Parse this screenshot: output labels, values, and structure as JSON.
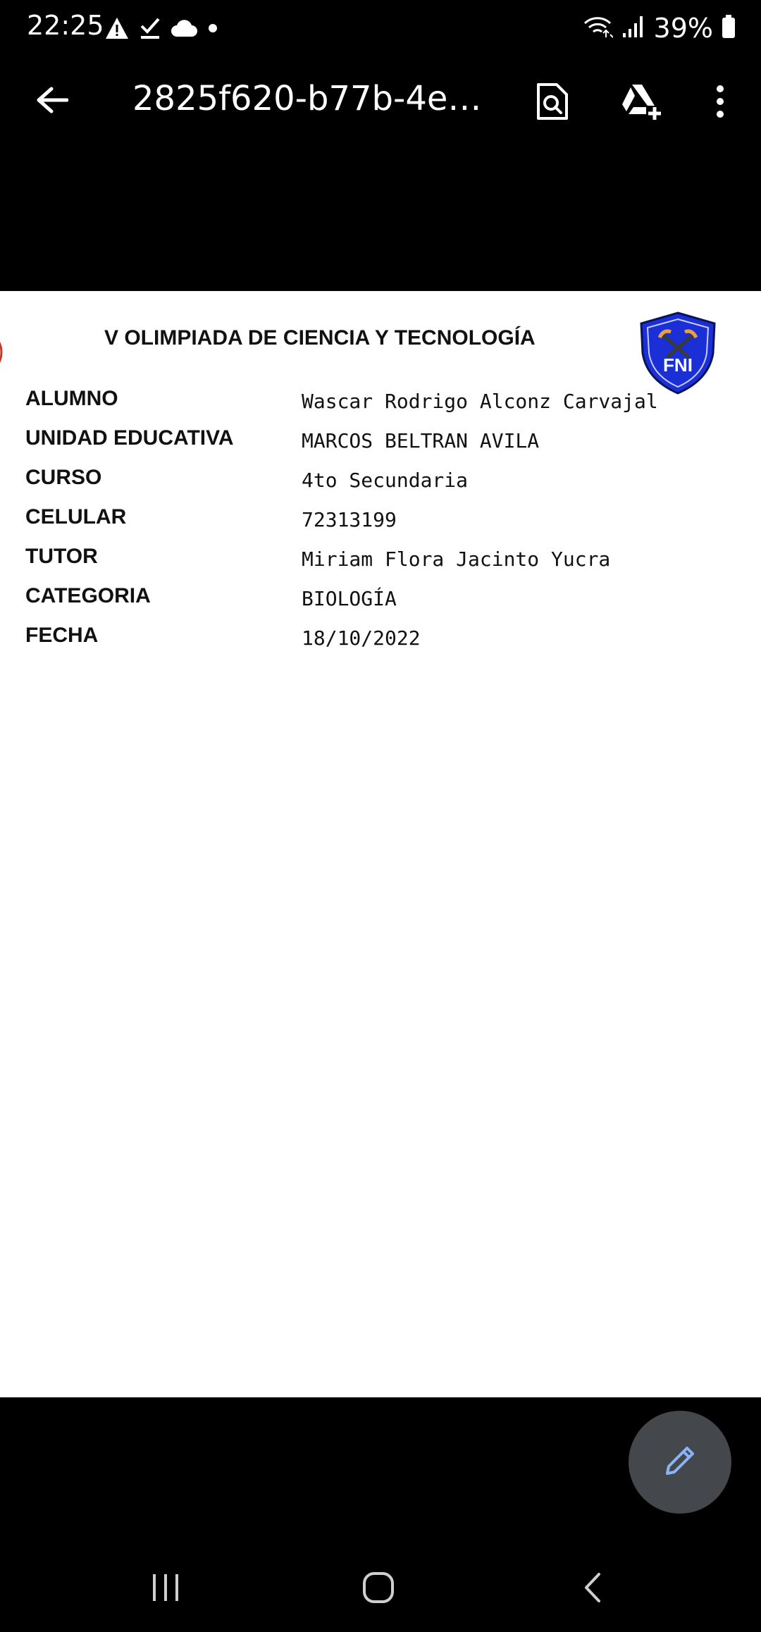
{
  "status_bar": {
    "time": "22:25",
    "battery_percent": "39%",
    "icons_left": [
      "warning-icon",
      "check-icon",
      "cloud-icon",
      "dot-icon"
    ],
    "icons_right": [
      "wifi-icon",
      "signal-icon",
      "battery-icon"
    ]
  },
  "app_bar": {
    "title": "2825f620-b77b-4e3f-...",
    "icons": [
      "back-arrow-icon",
      "search-document-icon",
      "drive-add-icon",
      "more-vert-icon"
    ]
  },
  "document": {
    "heading": "V OLIMPIADA DE CIENCIA Y TECNOLOGÍA",
    "logo_text": "FNI",
    "rows": [
      {
        "label": "ALUMNO",
        "value": "Wascar Rodrigo Alconz Carvajal"
      },
      {
        "label": "UNIDAD EDUCATIVA",
        "value": "MARCOS BELTRAN AVILA"
      },
      {
        "label": "CURSO",
        "value": "4to Secundaria"
      },
      {
        "label": "CELULAR",
        "value": "72313199"
      },
      {
        "label": "TUTOR",
        "value": "Miriam Flora Jacinto Yucra"
      },
      {
        "label": "CATEGORIA",
        "value": "BIOLOGÍA"
      },
      {
        "label": "FECHA",
        "value": "18/10/2022"
      }
    ]
  },
  "fab": {
    "icon": "pencil-icon",
    "color": "#44474c",
    "icon_color": "#8ab4f8"
  },
  "nav_bar": {
    "icons": [
      "recents-icon",
      "home-icon",
      "nav-back-icon"
    ]
  },
  "colors": {
    "background": "#000000",
    "page": "#ffffff",
    "logo_shield": "#1a2fd6"
  }
}
